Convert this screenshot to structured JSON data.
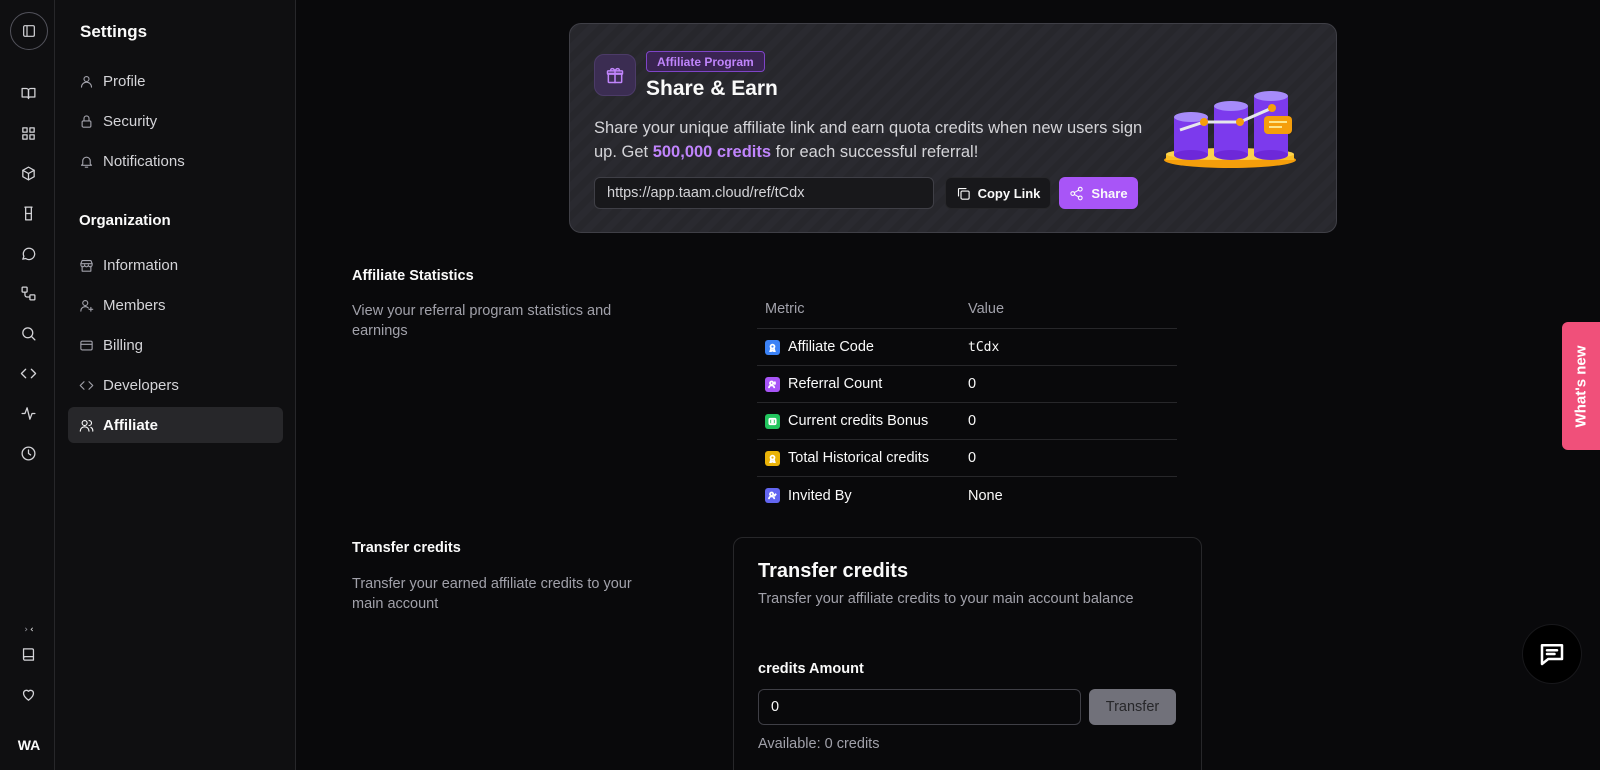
{
  "sidebar": {
    "title": "Settings",
    "account_items": [
      {
        "label": "Profile",
        "icon": "user-icon"
      },
      {
        "label": "Security",
        "icon": "lock-icon"
      },
      {
        "label": "Notifications",
        "icon": "bell-icon"
      }
    ],
    "organization_heading": "Organization",
    "org_items": [
      {
        "label": "Information",
        "icon": "store-icon"
      },
      {
        "label": "Members",
        "icon": "user-plus-icon"
      },
      {
        "label": "Billing",
        "icon": "credit-card-icon"
      },
      {
        "label": "Developers",
        "icon": "code-icon"
      },
      {
        "label": "Affiliate",
        "icon": "users-icon",
        "active": true
      }
    ]
  },
  "rail": {
    "avatar_initials": "WA",
    "icons": [
      "book-open-icon",
      "grid-icon",
      "box-icon",
      "flask-icon",
      "message-circle-icon",
      "workflow-icon",
      "search-icon",
      "code-icon",
      "activity-icon",
      "clock-icon"
    ],
    "bottom_icons": [
      "book-icon",
      "heart-icon"
    ]
  },
  "hero": {
    "badge": "Affiliate Program",
    "title": "Share & Earn",
    "desc_prefix": "Share your unique affiliate link and earn quota credits when new users sign up. Get ",
    "desc_highlight": "500,000 credits",
    "desc_suffix": " for each successful referral!",
    "referral_link": "https://app.taam.cloud/ref/tCdx",
    "copy_label": "Copy Link",
    "share_label": "Share"
  },
  "affiliate_stats": {
    "title": "Affiliate Statistics",
    "description": "View your referral program statistics and earnings",
    "columns": [
      "Metric",
      "Value"
    ],
    "rows": [
      {
        "metric": "Affiliate Code",
        "value": "tCdx",
        "color": "#3b82f6"
      },
      {
        "metric": "Referral Count",
        "value": "0",
        "color": "#a855f7"
      },
      {
        "metric": "Current credits Bonus",
        "value": "0",
        "color": "#22c55e"
      },
      {
        "metric": "Total Historical credits",
        "value": "0",
        "color": "#eab308"
      },
      {
        "metric": "Invited By",
        "value": "None",
        "color": "#6366f1"
      }
    ]
  },
  "transfer": {
    "section_title": "Transfer credits",
    "section_desc": "Transfer your earned affiliate credits to your main account",
    "card_title": "Transfer credits",
    "card_subtitle": "Transfer your affiliate credits to your main account balance",
    "amount_label": "credits Amount",
    "amount_value": "0",
    "button_label": "Transfer",
    "available": "Available: 0 credits"
  },
  "whats_new": "What's new",
  "colors": {
    "accent": "#a855f7",
    "whats_new_bg": "#f0507a",
    "background": "#09090b"
  }
}
